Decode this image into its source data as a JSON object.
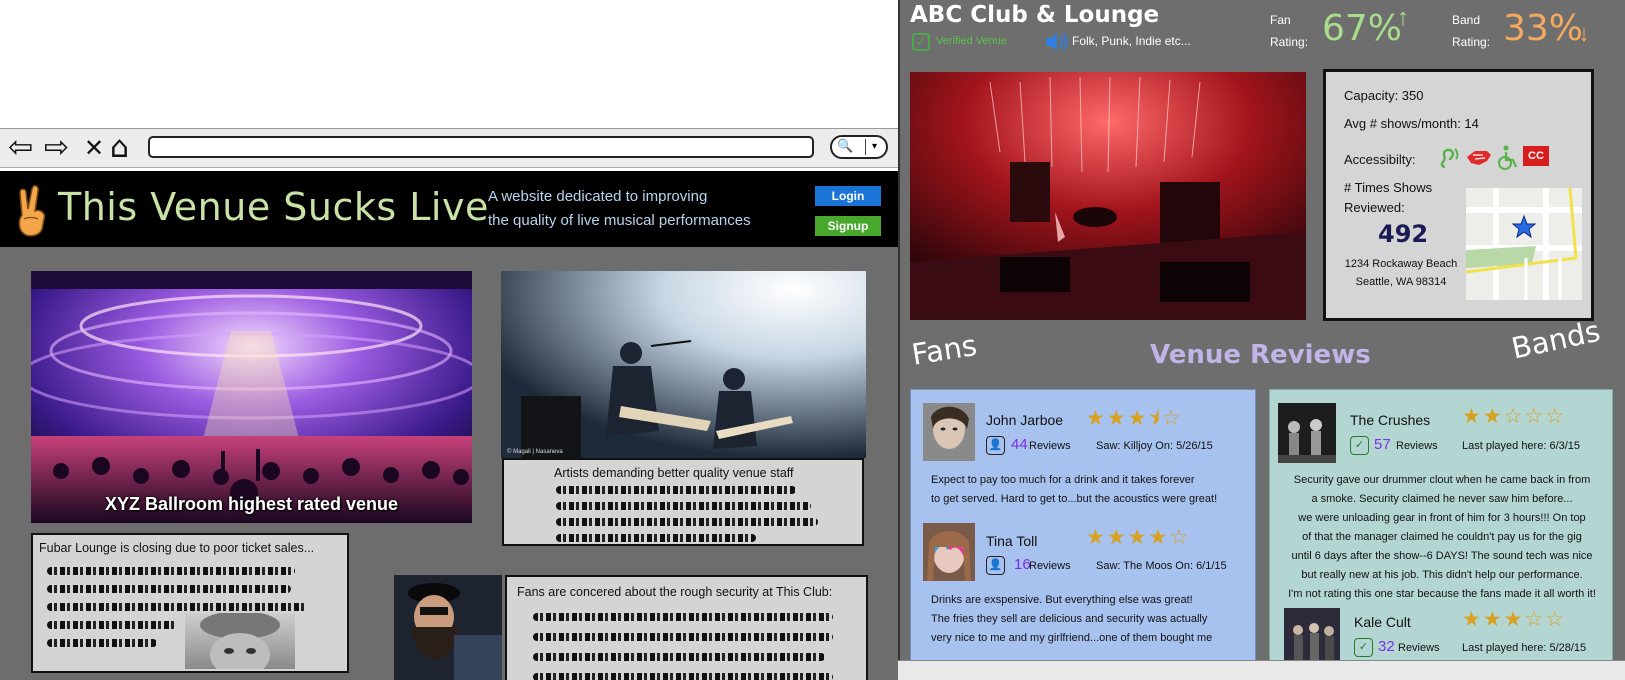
{
  "site": {
    "title": "This Venue Sucks Live",
    "tagline_line1": "A website dedicated to improving",
    "tagline_line2": "the quality of live musical performances",
    "login_label": "Login",
    "signup_label": "Signup"
  },
  "browser": {
    "back_icon": "arrow-left-icon",
    "forward_icon": "arrow-right-icon",
    "close_icon": "close-icon",
    "home_icon": "home-icon"
  },
  "feed": {
    "featured_caption": "XYZ Ballroom highest rated venue",
    "artists_headline": "Artists demanding better quality venue staff",
    "fubar_headline": "Fubar Lounge is closing due to poor ticket sales...",
    "fans_headline": "Fans are concered about the rough security at This Club:",
    "photo_credit": "© Magali | Nasaneva"
  },
  "venue": {
    "name": "ABC Club & Lounge",
    "verified_label": "Verified Venue",
    "genres": "Folk, Punk, Indie etc...",
    "fan_rating_label_1": "Fan",
    "fan_rating_label_2": "Rating:",
    "fan_rating": "67%",
    "fan_rating_arrow": "↑",
    "band_rating_label_1": "Band",
    "band_rating_label_2": "Rating:",
    "band_rating": "33%",
    "band_rating_arrow": "↓",
    "capacity": "Capacity:  350",
    "avg_shows": "Avg # shows/month: 14",
    "accessibility_label": "Accessibilty:",
    "times_reviewed_1": "# Times Shows",
    "times_reviewed_2": "Reviewed:",
    "times_reviewed_count": "492",
    "address_1": "1234 Rockaway Beach",
    "address_2": "Seattle, WA 98314",
    "accessibility_icons": [
      "hearing-assist-icon",
      "sign-language-icon",
      "wheelchair-icon",
      "closed-caption-icon"
    ],
    "colors": {
      "fan_rating": "#a7dd8b",
      "band_rating": "#f4a95e",
      "verified": "#59c24a"
    }
  },
  "reviews": {
    "fans_heading": "Fans",
    "venue_heading": "Venue Reviews",
    "bands_heading": "Bands",
    "fans": [
      {
        "name": "John Jarboe",
        "stars": 3.5,
        "review_count": "44",
        "reviews_label": "Reviews",
        "meta": "Saw: Killjoy On: 5/26/15",
        "body_1": "Expect to pay too much for a drink and it takes forever",
        "body_2": "to get served. Hard to get to...but the acoustics were great!"
      },
      {
        "name": "Tina Toll",
        "stars": 4,
        "review_count": "16",
        "reviews_label": " Reviews",
        "meta": "Saw: The Moos On: 6/1/15",
        "body_1": "Drinks are exspensive. But everything else was great!",
        "body_2": "The fries they sell are delicious and security was actually",
        "body_3": "very nice to me and my girlfriend...one of them bought me"
      }
    ],
    "bands": [
      {
        "name": "The Crushes",
        "stars": 2,
        "review_count": "57",
        "reviews_label": "Reviews",
        "meta": "Last played here: 6/3/15",
        "body_1": "Security gave our drummer clout when he came back in from",
        "body_2": "a smoke. Security claimed he never saw him before...",
        "body_3": "we were unloading gear in front of him for 3 hours!!! On top",
        "body_4": "of that the manager claimed he couldn't pay us for the gig",
        "body_5": "until 6 days after the show--6 DAYS! The sound tech was nice",
        "body_6": "but really new at his job. This didn't help our performance.",
        "body_7": "I'm not rating this one star because the fans made it all worth it!"
      },
      {
        "name": "Kale Cult",
        "stars": 3,
        "review_count": "32",
        "reviews_label": "Reviews",
        "meta": "Last played here: 5/28/15"
      }
    ]
  }
}
